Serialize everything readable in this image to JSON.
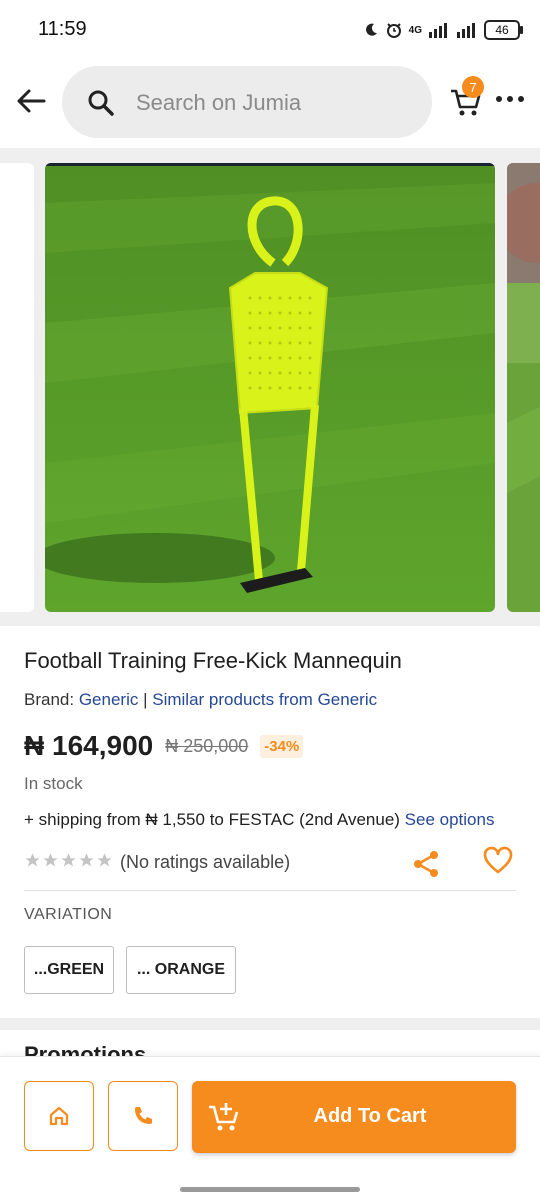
{
  "status_bar": {
    "time": "11:59",
    "network": "4G",
    "battery": "46"
  },
  "header": {
    "search_placeholder": "Search on Jumia",
    "cart_count": "7"
  },
  "product": {
    "title": "Football Training Free-Kick Mannequin",
    "brand_label": "Brand:",
    "brand_name": "Generic",
    "separator": "|",
    "similar_link": "Similar products from Generic",
    "price": "₦ 164,900",
    "old_price": "₦ 250,000",
    "discount": "-34%",
    "stock": "In stock",
    "shipping_text": "+ shipping from ₦ 1,550 to FESTAC (2nd Avenue)",
    "shipping_link": "See options",
    "ratings_text": "(No ratings available)",
    "rating_value": 0,
    "rating_max": 5
  },
  "variation": {
    "label": "VARIATION",
    "options": [
      "...GREEN",
      "... ORANGE"
    ]
  },
  "promotions": {
    "title": "Promotions"
  },
  "bottom_bar": {
    "add_to_cart": "Add To Cart"
  },
  "colors": {
    "accent": "#f68b1e",
    "link": "#264996",
    "mannequin": "#d8f21a",
    "grass": "#5a9a2a"
  }
}
